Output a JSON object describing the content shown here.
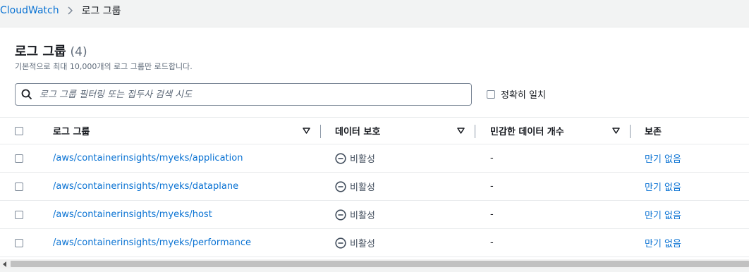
{
  "breadcrumb": {
    "root": "CloudWatch",
    "current": "로그 그룹"
  },
  "panel": {
    "title": "로그 그룹",
    "count": "(4)",
    "description": "기본적으로 최대 10,000개의 로그 그룹만 로드합니다."
  },
  "search": {
    "placeholder": "로그 그룹 필터링 또는 접두사 검색 시도",
    "value": ""
  },
  "exact_match": {
    "label": "정확히 일치",
    "checked": false
  },
  "table": {
    "columns": [
      "로그 그룹",
      "데이터 보호",
      "민감한 데이터 개수",
      "보존"
    ],
    "rows": [
      {
        "name": "/aws/containerinsights/myeks/application",
        "protection": "비활성",
        "sensitive": "-",
        "retention": "만기 없음"
      },
      {
        "name": "/aws/containerinsights/myeks/dataplane",
        "protection": "비활성",
        "sensitive": "-",
        "retention": "만기 없음"
      },
      {
        "name": "/aws/containerinsights/myeks/host",
        "protection": "비활성",
        "sensitive": "-",
        "retention": "만기 없음"
      },
      {
        "name": "/aws/containerinsights/myeks/performance",
        "protection": "비활성",
        "sensitive": "-",
        "retention": "만기 없음"
      }
    ]
  },
  "colors": {
    "link": "#0972d3",
    "text": "#16191f",
    "muted": "#5f6b7a",
    "border": "#e9ebed"
  },
  "icons": {
    "separator": "chevron-right-icon",
    "search": "search-icon",
    "sort": "caret-down-icon",
    "status": "minus-circle-icon",
    "scroll": "arrow-left-icon"
  }
}
